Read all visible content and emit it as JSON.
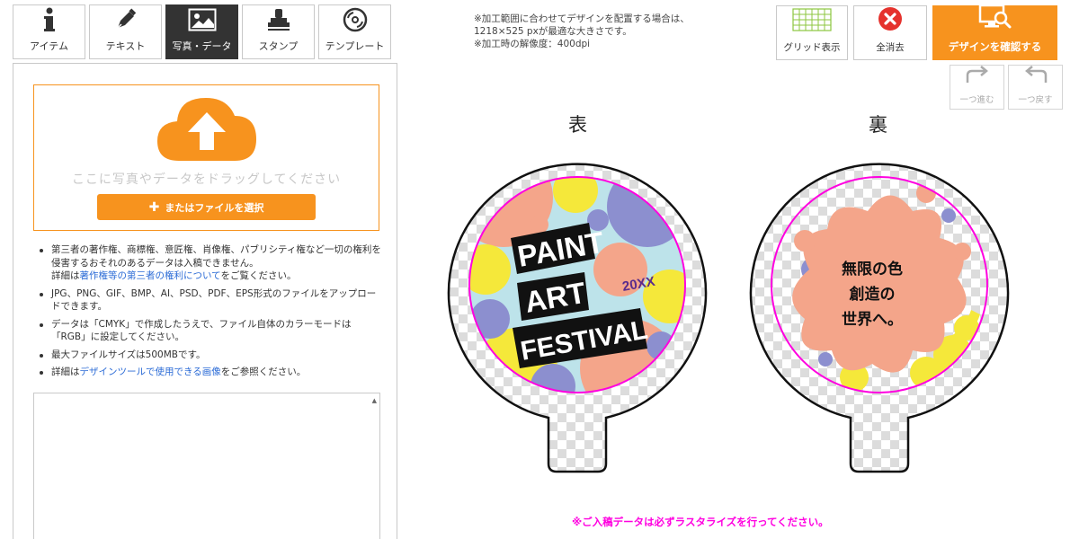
{
  "tabs": [
    {
      "label": "アイテム",
      "icon": "info-icon"
    },
    {
      "label": "テキスト",
      "icon": "pen-icon"
    },
    {
      "label": "写真・データ",
      "icon": "image-icon"
    },
    {
      "label": "スタンプ",
      "icon": "stamp-icon"
    },
    {
      "label": "テンプレート",
      "icon": "disc-icon"
    }
  ],
  "notes_top": [
    "※加工範囲に合わせてデザインを配置する場合は、",
    "1218×525 pxが最適な大きさです。",
    "※加工時の解像度：400dpi"
  ],
  "toolbar": {
    "grid_label": "グリッド表示",
    "clear_label": "全消去",
    "confirm_label": "デザインを確認する",
    "redo_label": "一つ進む",
    "undo_label": "一つ戻す"
  },
  "upload": {
    "drop_text": "ここに写真やデータをドラッグしてください",
    "file_button": "またはファイルを選択"
  },
  "notes": {
    "n1a": "第三者の著作権、商標権、意匠権、肖像権、パブリシティ権など一切の権利を侵害するおそれのあるデータは入稿できません。",
    "n1b": "詳細は",
    "n1link": "著作権等の第三者の権利について",
    "n1c": "をご覧ください。",
    "n2": "JPG、PNG、GIF、BMP、AI、PSD、PDF、EPS形式のファイルをアップロードできます。",
    "n3": "データは「CMYK」で作成したうえで、ファイル自体のカラーモードは「RGB」に設定してください。",
    "n4": "最大ファイルサイズは500MBです。",
    "n5a": "詳細は",
    "n5link": "デザインツールで使用できる画像",
    "n5b": "をご参照ください。"
  },
  "preview": {
    "front_label": "表",
    "back_label": "裏",
    "front_design": {
      "line1": "PAINT",
      "line2": "ART",
      "line3": "FESTIVAL",
      "year": "20XX"
    },
    "back_design": {
      "line1": "無限の色",
      "line2": "創造の",
      "line3": "世界へ。"
    },
    "warning": "※ご入稿データは必ずラスタライズを行ってください。"
  },
  "colors": {
    "accent": "#f7931e",
    "guide": "#ff00e0",
    "salmon": "#f4a58a",
    "yellow": "#f5e83a",
    "purple": "#8c8fcf"
  }
}
